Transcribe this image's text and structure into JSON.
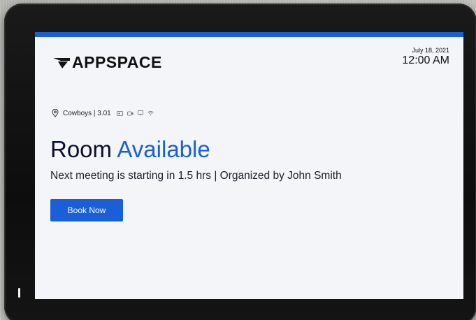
{
  "brand": {
    "name": "APPSPACE",
    "accent_color": "#1a5fd8"
  },
  "clock": {
    "date": "July 18, 2021",
    "time": "12:00 AM"
  },
  "room": {
    "location": "Cowboys | 3.01",
    "amenities": [
      "display-icon",
      "video-camera-icon",
      "monitor-icon",
      "wifi-icon"
    ],
    "headline_prefix": "Room",
    "headline_status": "Available",
    "next_meeting_text": "Next meeting is starting in 1.5 hrs | Organized by John Smith"
  },
  "actions": {
    "book_label": "Book Now"
  }
}
